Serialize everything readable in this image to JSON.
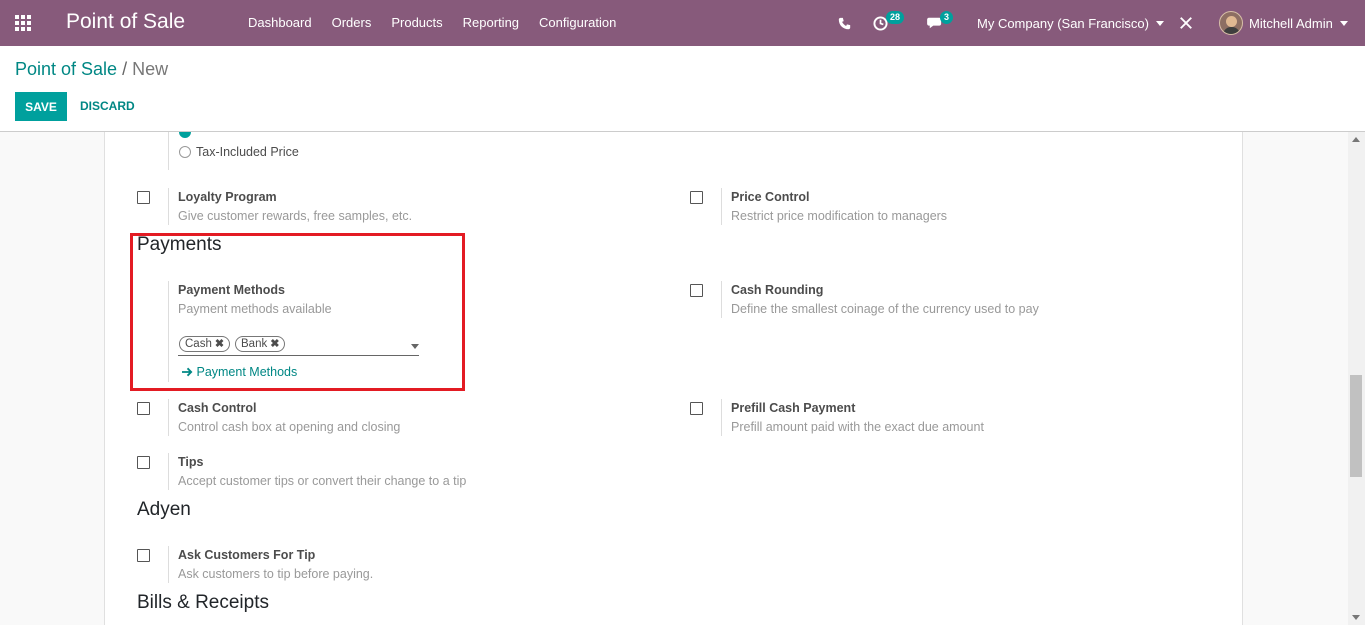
{
  "navbar": {
    "brand": "Point of Sale",
    "menu": [
      "Dashboard",
      "Orders",
      "Products",
      "Reporting",
      "Configuration"
    ],
    "activity_count": "28",
    "message_count": "3",
    "company": "My Company (San Francisco)",
    "user": "Mitchell Admin",
    "color": "#875a7b"
  },
  "control_panel": {
    "breadcrumb_parent": "Point of Sale",
    "breadcrumb_separator": "/",
    "breadcrumb_current": "New",
    "save_label": "SAVE",
    "discard_label": "DISCARD"
  },
  "settings": {
    "tax_included_label": "Tax-Included Price",
    "loyalty": {
      "title": "Loyalty Program",
      "desc": "Give customer rewards, free samples, etc.",
      "checked": false
    },
    "price_control": {
      "title": "Price Control",
      "desc": "Restrict price modification to managers",
      "checked": false
    },
    "payments_section": "Payments",
    "payment_methods": {
      "title": "Payment Methods",
      "desc": "Payment methods available",
      "tags": [
        "Cash",
        "Bank"
      ],
      "link": "Payment Methods"
    },
    "cash_rounding": {
      "title": "Cash Rounding",
      "desc": "Define the smallest coinage of the currency used to pay",
      "checked": false
    },
    "cash_control": {
      "title": "Cash Control",
      "desc": "Control cash box at opening and closing",
      "checked": false
    },
    "prefill_cash": {
      "title": "Prefill Cash Payment",
      "desc": "Prefill amount paid with the exact due amount",
      "checked": false
    },
    "tips": {
      "title": "Tips",
      "desc": "Accept customer tips or convert their change to a tip",
      "checked": false
    },
    "adyen_section": "Adyen",
    "ask_tip": {
      "title": "Ask Customers For Tip",
      "desc": "Ask customers to tip before paying.",
      "checked": false
    },
    "bills_section": "Bills & Receipts"
  },
  "colors": {
    "accent": "#00a09d",
    "link": "#008784",
    "highlight": "#e31b23"
  }
}
